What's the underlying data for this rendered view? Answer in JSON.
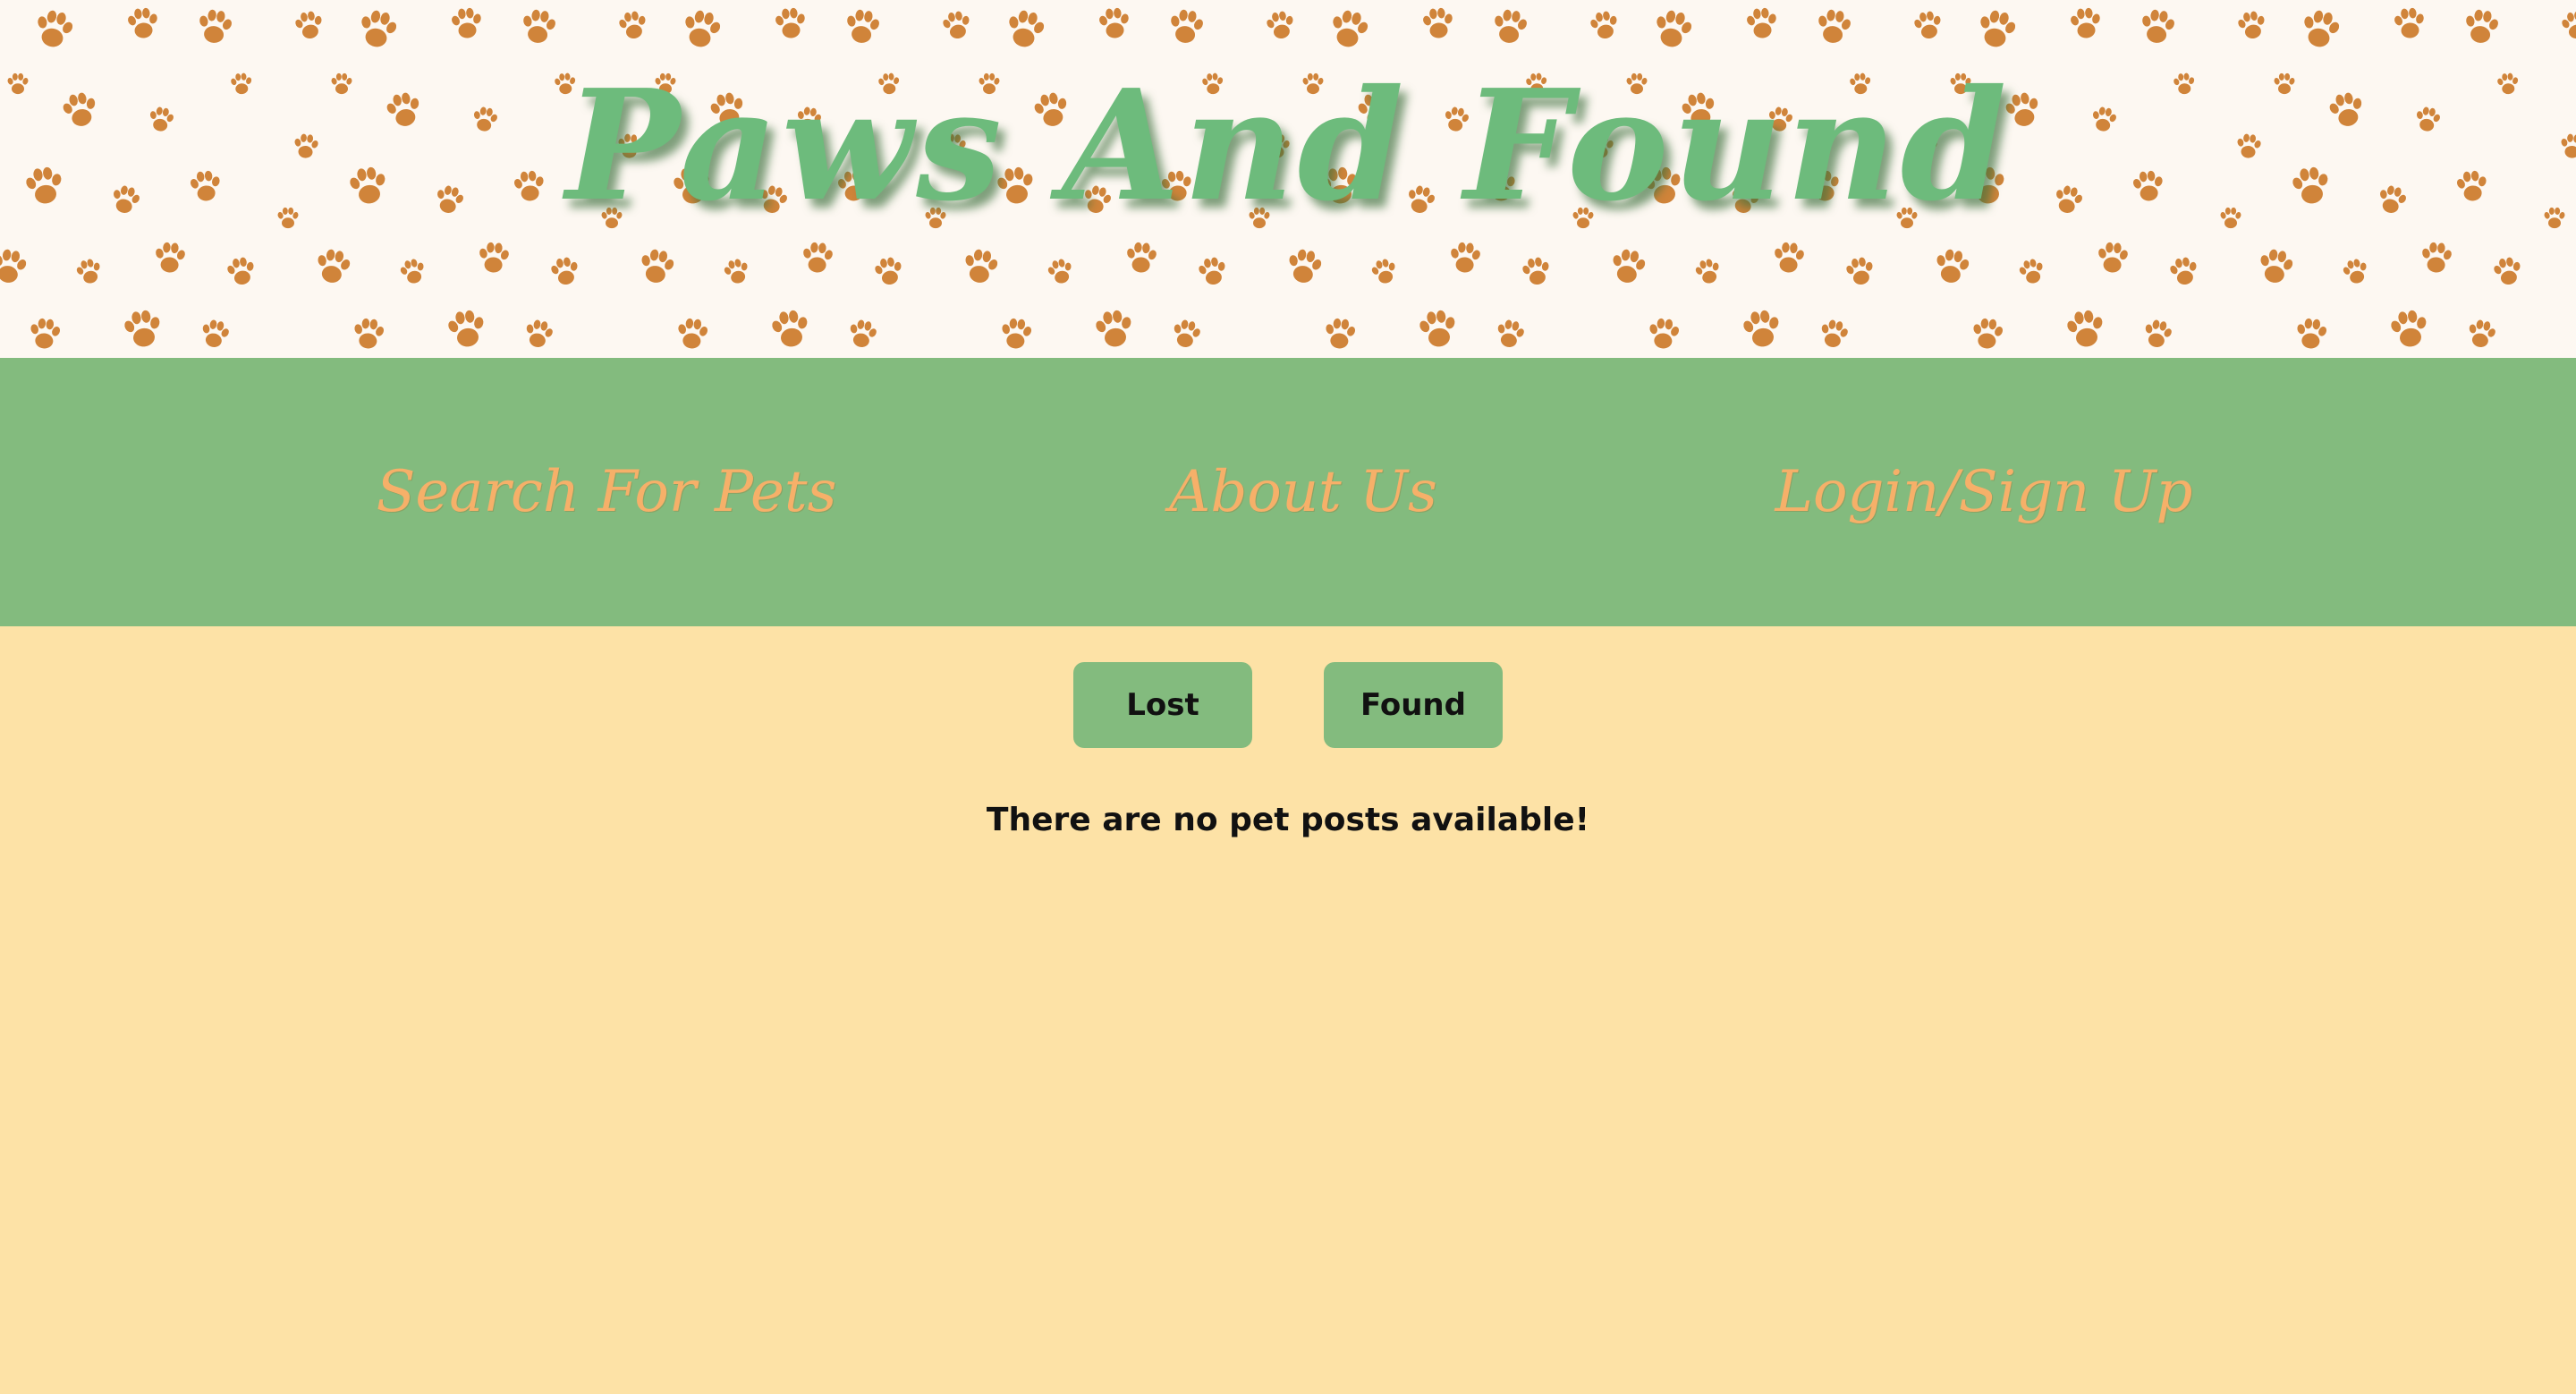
{
  "header": {
    "title": "Paws And Found"
  },
  "nav": {
    "search_label": "Search For Pets",
    "about_label": "About Us",
    "login_label": "Login/Sign Up"
  },
  "filters": {
    "lost_label": "Lost",
    "found_label": "Found"
  },
  "main": {
    "empty_message": "There are no pet posts available!"
  },
  "icons": {
    "banner_pattern": "paw-print-icon"
  },
  "colors": {
    "banner_background": "#fdf8f2",
    "paw_print": "#d0843a",
    "title_green": "#6dbb7c",
    "nav_background": "#83bb7e",
    "nav_text": "#f6b069",
    "page_background": "#fde2a6",
    "button_background": "#83bb7e",
    "text_dark": "#111111"
  }
}
